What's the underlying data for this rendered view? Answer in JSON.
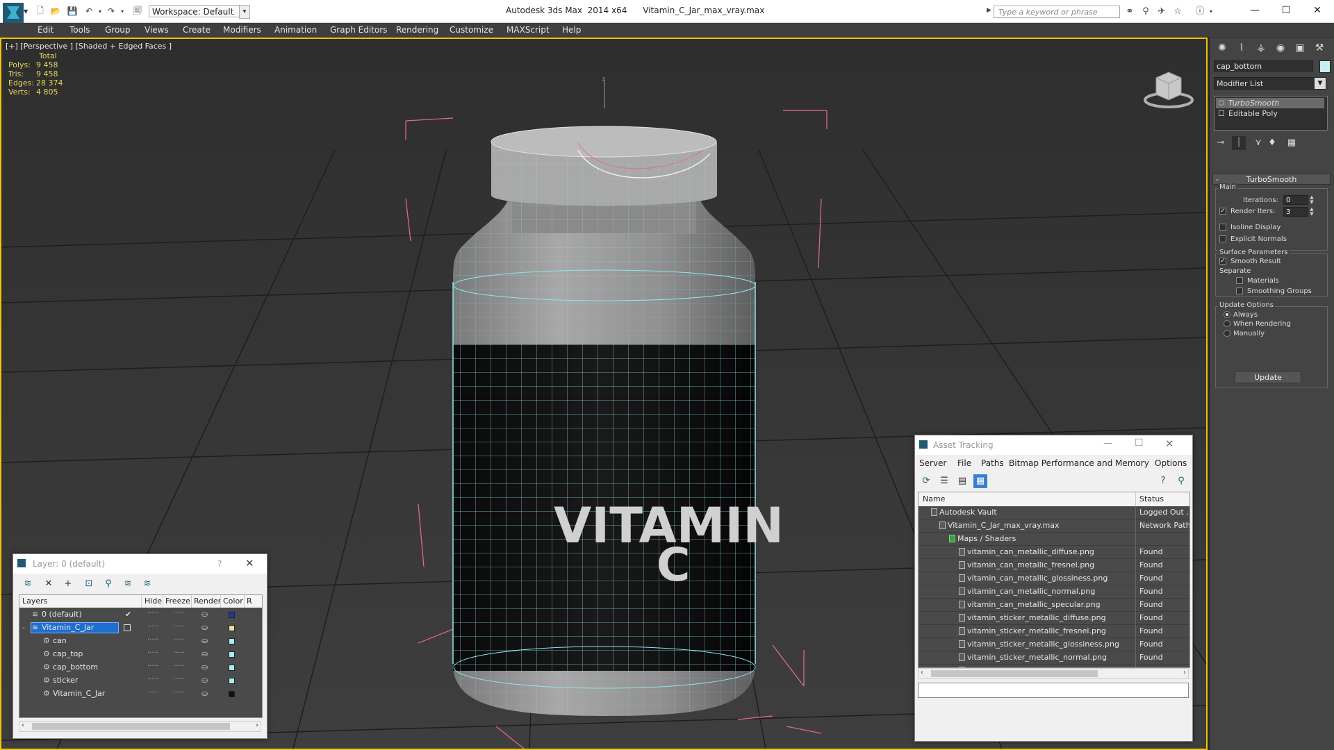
{
  "titlebar": {
    "workspace": "Workspace: Default",
    "app_name": "Autodesk 3ds Max  2014 x64",
    "file_name": "Vitamin_C_Jar_max_vray.max",
    "search_placeholder": "Type a keyword or phrase"
  },
  "menu": [
    "Edit",
    "Tools",
    "Group",
    "Views",
    "Create",
    "Modifiers",
    "Animation",
    "Graph Editors",
    "Rendering",
    "Customize",
    "MAXScript",
    "Help"
  ],
  "viewport": {
    "label": "[+] [Perspective ] [Shaded + Edged Faces ]",
    "stats": {
      "header": "Total",
      "rows": [
        {
          "label": "Polys:",
          "value": "9 458"
        },
        {
          "label": "Tris:",
          "value": "9 458"
        },
        {
          "label": "Edges:",
          "value": "28 374"
        },
        {
          "label": "Verts:",
          "value": "4 805"
        }
      ]
    },
    "sticker_text_1": "VITAMIN",
    "sticker_text_2": "C",
    "accent": "#f2c600",
    "wire_color": "#8ee6ee",
    "bbox_color": "#e86a9a"
  },
  "command_panel": {
    "object_name": "cap_bottom",
    "object_color": "#c9eef5",
    "modifier_list": "Modifier List",
    "stack": [
      "TurboSmooth",
      "Editable Poly"
    ],
    "rollout_title": "TurboSmooth",
    "main_group": "Main",
    "iterations_label": "Iterations:",
    "iterations_value": "0",
    "render_iters_label": "Render Iters:",
    "render_iters_value": "3",
    "isoline": "Isoline Display",
    "explicit_normals": "Explicit Normals",
    "surface_params": "Surface Parameters",
    "smooth_result": "Smooth Result",
    "separate": "Separate",
    "materials": "Materials",
    "smoothing_groups": "Smoothing Groups",
    "update_options": "Update Options",
    "always": "Always",
    "when_rendering": "When Rendering",
    "manually": "Manually",
    "update_button": "Update"
  },
  "layer_window": {
    "title": "Layer: 0 (default)",
    "help": "?",
    "columns": [
      "Layers",
      "Hide",
      "Freeze",
      "Render",
      "Color",
      "R"
    ],
    "rows": [
      {
        "name": "0 (default)",
        "color": "#1e3aa0",
        "check": "✔"
      },
      {
        "name": "Vitamin_C_Jar",
        "color": "#e8e0a0",
        "selected": true
      },
      {
        "name": "can",
        "color": "#a8f0f0"
      },
      {
        "name": "cap_top",
        "color": "#a8f0f0"
      },
      {
        "name": "cap_bottom",
        "color": "#a8f0f0"
      },
      {
        "name": "sticker",
        "color": "#a8f0f0"
      },
      {
        "name": "Vitamin_C_Jar",
        "color": "#111111"
      }
    ]
  },
  "asset_window": {
    "title": "Asset Tracking",
    "menu": [
      "Server",
      "File",
      "Paths",
      "Bitmap Performance and Memory",
      "Options"
    ],
    "columns": [
      "Name",
      "Status"
    ],
    "rows": [
      {
        "name": "Autodesk Vault",
        "status": "Logged Out ..",
        "indent": 0
      },
      {
        "name": "Vitamin_C_Jar_max_vray.max",
        "status": "Network Path",
        "indent": 1
      },
      {
        "name": "Maps / Shaders",
        "status": "",
        "indent": 2
      },
      {
        "name": "vitamin_can_metallic_diffuse.png",
        "status": "Found",
        "indent": 3
      },
      {
        "name": "vitamin_can_metallic_fresnel.png",
        "status": "Found",
        "indent": 3
      },
      {
        "name": "vitamin_can_metallic_glossiness.png",
        "status": "Found",
        "indent": 3
      },
      {
        "name": "vitamin_can_metallic_normal.png",
        "status": "Found",
        "indent": 3
      },
      {
        "name": "vitamin_can_metallic_specular.png",
        "status": "Found",
        "indent": 3
      },
      {
        "name": "vitamin_sticker_metallic_diffuse.png",
        "status": "Found",
        "indent": 3
      },
      {
        "name": "vitamin_sticker_metallic_fresnel.png",
        "status": "Found",
        "indent": 3
      },
      {
        "name": "vitamin_sticker_metallic_glossiness.png",
        "status": "Found",
        "indent": 3
      },
      {
        "name": "vitamin_sticker_metallic_normal.png",
        "status": "Found",
        "indent": 3
      },
      {
        "name": "vitamin_sticker_metallic_specular.png",
        "status": "Found",
        "indent": 3
      }
    ]
  }
}
